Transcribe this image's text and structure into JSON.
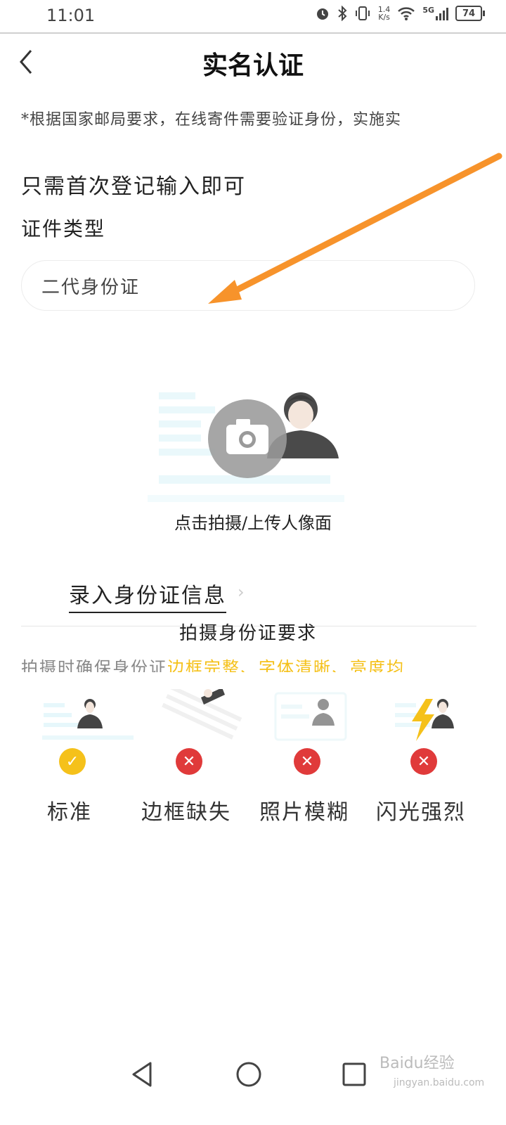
{
  "status_bar": {
    "time": "11:01",
    "net_speed_top": "1.4",
    "net_speed_bottom": "K/s",
    "network": "5G",
    "battery": "74"
  },
  "header": {
    "title": "实名认证"
  },
  "notice": "*根据国家邮局要求，在线寄件需要验证身份，实施实",
  "subtitle": "只需首次登记输入即可",
  "id_type": {
    "label": "证件类型",
    "value": "二代身份证"
  },
  "upload": {
    "label": "点击拍摄/上传人像面"
  },
  "entry_link": "录入身份证信息",
  "requirements": {
    "title": "拍摄身份证要求",
    "text_prefix": "拍摄时确保身份证",
    "highlight_1": "边框完整",
    "sep": "、",
    "highlight_2": "字体清晰",
    "highlight_3": "亮度均"
  },
  "samples": [
    {
      "label": "标准",
      "status": "ok"
    },
    {
      "label": "边框缺失",
      "status": "error"
    },
    {
      "label": "照片模糊",
      "status": "error"
    },
    {
      "label": "闪光强烈",
      "status": "error"
    }
  ],
  "watermark": {
    "brand": "Baidu经验",
    "url": "jingyan.baidu.com"
  },
  "colors": {
    "accent": "#f5c11a",
    "error": "#e03a3a",
    "arrow": "#f7932b"
  }
}
